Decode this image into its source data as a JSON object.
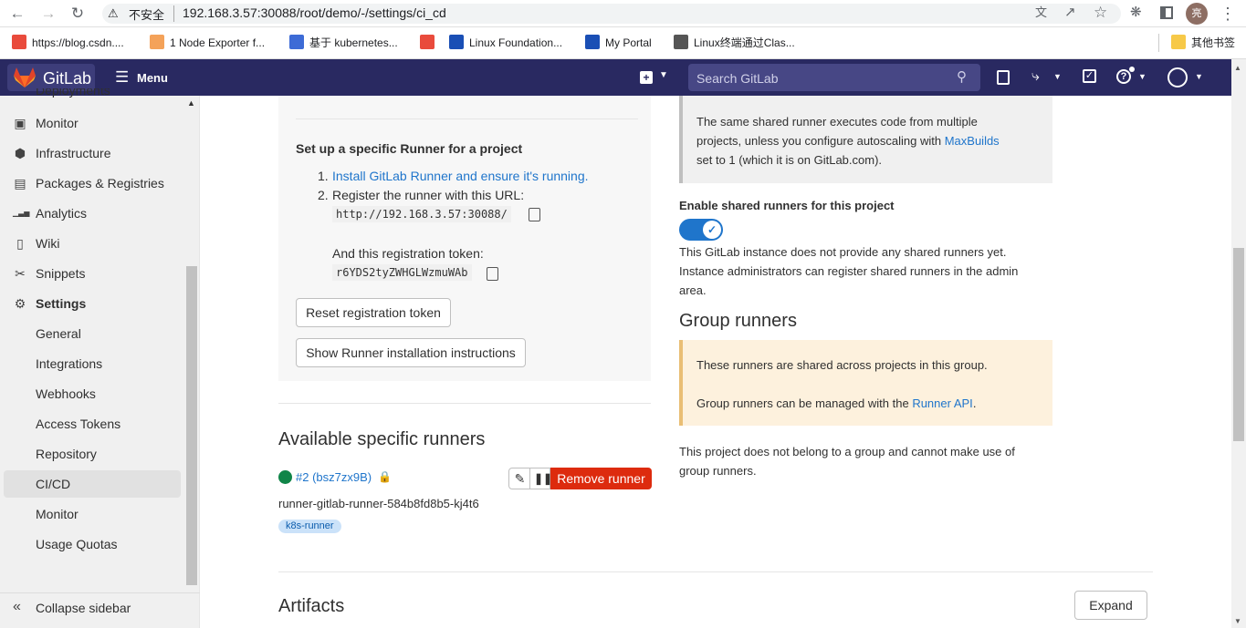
{
  "browser": {
    "url_security": "不安全",
    "url": "192.168.3.57:30088/root/demo/-/settings/ci_cd",
    "avatar_text": "亮",
    "bookmarks": [
      {
        "label": "https://blog.csdn....",
        "color": "#e94b3c"
      },
      {
        "label": "1 Node Exporter f...",
        "color": "#f4a259"
      },
      {
        "label": "基于 kubernetes...",
        "color": "#3d6bd6"
      },
      {
        "label": "",
        "color": "#e94b3c"
      },
      {
        "label": "Linux Foundation...",
        "color": "#1a4fb5"
      },
      {
        "label": "My Portal",
        "color": "#1a4fb5"
      },
      {
        "label": "Linux终端通过Clas...",
        "color": "#555555"
      }
    ],
    "other_bookmarks": "其他书签"
  },
  "gitlab": {
    "brand": "GitLab",
    "menu": "Menu",
    "search_placeholder": "Search GitLab"
  },
  "sidebar": {
    "partial_item": "Deployments",
    "items": [
      {
        "label": "Monitor",
        "icon": "monitor-icon"
      },
      {
        "label": "Infrastructure",
        "icon": "infrastructure-icon"
      },
      {
        "label": "Packages & Registries",
        "icon": "package-icon"
      },
      {
        "label": "Analytics",
        "icon": "analytics-icon"
      },
      {
        "label": "Wiki",
        "icon": "wiki-icon"
      },
      {
        "label": "Snippets",
        "icon": "snippets-icon"
      },
      {
        "label": "Settings",
        "icon": "settings-icon"
      }
    ],
    "sub_items": [
      "General",
      "Integrations",
      "Webhooks",
      "Access Tokens",
      "Repository",
      "CI/CD",
      "Monitor",
      "Usage Quotas"
    ],
    "collapse": "Collapse sidebar"
  },
  "specific": {
    "setup_title": "Set up a specific Runner for a project",
    "step1_num": "1.",
    "step1_link": "Install GitLab Runner and ensure it's running.",
    "step2_num": "2.",
    "step2_text": "Register the runner with this URL:",
    "url": "http://192.168.3.57:30088/",
    "token_label": "And this registration token:",
    "token": "r6YDS2tyZWHGLWzmuWAb",
    "reset_button": "Reset registration token",
    "show_instructions_button": "Show Runner installation instructions",
    "available_title": "Available specific runners",
    "runner_id": "#2 (bsz7zx9B)",
    "runner_name": "runner-gitlab-runner-584b8fd8b5-kj4t6",
    "runner_tag": "k8s-runner",
    "remove_button": "Remove runner"
  },
  "shared": {
    "info_text_1": "The same shared runner executes code from multiple",
    "info_text_2a": "projects, unless you configure autoscaling with ",
    "info_link": "MaxBuilds",
    "info_text_3": "set to 1 (which it is on GitLab.com).",
    "enable_label": "Enable shared runners for this project",
    "toggle_on": true,
    "none_text_1": "This GitLab instance does not provide any shared runners yet.",
    "none_text_2": "Instance administrators can register shared runners in the admin",
    "none_text_3": "area."
  },
  "group": {
    "title": "Group runners",
    "warn_1": "These runners are shared across projects in this group.",
    "warn_2a": "Group runners can be managed with the ",
    "warn_link": "Runner API",
    "warn_2b": ".",
    "note_1": "This project does not belong to a group and cannot make use of",
    "note_2": "group runners."
  },
  "artifacts": {
    "title": "Artifacts",
    "expand_button": "Expand"
  }
}
